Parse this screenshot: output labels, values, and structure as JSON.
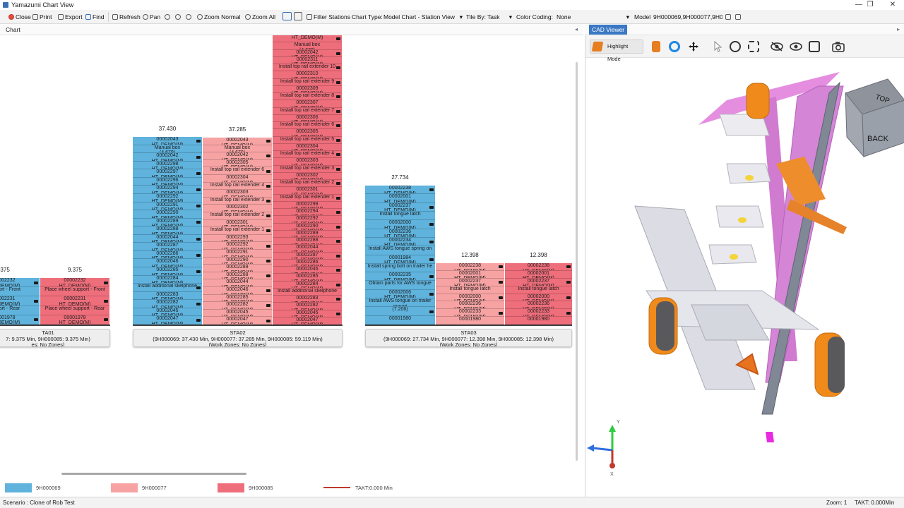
{
  "window": {
    "title": "Yamazumi Chart View",
    "minimize": "—",
    "maximize": "❐",
    "close": "✕"
  },
  "toolbar": {
    "close": "Close",
    "print": "Print",
    "export": "Export",
    "find": "Find",
    "refresh": "Refresh",
    "pan": "Pan",
    "zoom_normal": "Zoom Normal",
    "zoom_all": "Zoom All",
    "filter_stations": "Filter Stations",
    "chart_type_label": "Chart Type:",
    "chart_type_value": "Model Chart - Station View",
    "tile_by_label": "Tile By:",
    "tile_by_value": "Task",
    "color_coding_label": "Color Coding:",
    "color_coding_value": "None",
    "model_label": "Model",
    "model_value": "9H000069,9H000077,9H000("
  },
  "tabs": {
    "chart": "Chart",
    "cad": "CAD Viewer"
  },
  "colors": {
    "c69": "#5fb3dd",
    "c77": "#f7a3a3",
    "c85": "#ee6e7b",
    "takt": "#c0392b"
  },
  "chart": {
    "columns": [
      {
        "color": "c69",
        "top": "",
        "cells": [
          [
            "00002232",
            "HT_DEMO(M)"
          ],
          [
            "support - Front",
            ""
          ],
          [
            "00002231",
            "HT_DEMO(M)"
          ],
          [
            "support - Rear",
            ""
          ],
          [
            "00001978",
            "HT_DEMO(M)"
          ]
        ],
        "top_value": ".375"
      },
      {
        "color": "c85",
        "top": "",
        "cells": [
          [
            "00002232",
            "HT_DEMO(M)"
          ],
          [
            "Place wheel support - Front",
            ""
          ],
          [
            "00002231",
            "HT_DEMO(M)"
          ],
          [
            "Place wheel support - Rear",
            ""
          ],
          [
            "00001978",
            "HT_DEMO(M)"
          ]
        ],
        "top_value": "9.375"
      },
      {
        "color": "c69",
        "top_value": "37.430",
        "cells": [
          [
            "00002043",
            "HT_DEMO(M)"
          ],
          [
            "Manual box",
            "(4.679)"
          ],
          [
            "00002042",
            "HT_DEMO(M)"
          ],
          [
            "00002298",
            "HT_DEMO(M)"
          ],
          [
            "00002297",
            "HT_DEMO(M)"
          ],
          [
            "00002296",
            "HT_DEMO(M)"
          ],
          [
            "00002294",
            "HT_DEMO(M)"
          ],
          [
            "00002292",
            "HT_DEMO(M)"
          ],
          [
            "00002291",
            "HT_DEMO(M)"
          ],
          [
            "00002290",
            "HT_DEMO(M)"
          ],
          [
            "00002289",
            "HT_DEMO(M)"
          ],
          [
            "00002288",
            "HT_DEMO(M)"
          ],
          [
            "00002044",
            "HT_DEMO(M)"
          ],
          [
            "00002287",
            "HT_DEMO(M)"
          ],
          [
            "00002286",
            "HT_DEMO(M)"
          ],
          [
            "00002046",
            "HT_DEMO(M)"
          ],
          [
            "00002285",
            "HT_DEMO(M)"
          ],
          [
            "00002284",
            "HT_DEMO(M)"
          ],
          [
            "Install additional skelphone",
            ""
          ],
          [
            "00002283",
            "HT_DEMO(M)"
          ],
          [
            "00002282",
            "HT_DEMO(M)"
          ],
          [
            "00002045",
            "HT_DEMO(M)"
          ],
          [
            "00002047",
            "HT_DEMO(M)"
          ]
        ]
      },
      {
        "color": "c77",
        "top_value": "37.285",
        "cells": [
          [
            "00002043",
            "HT_DEMO(M)"
          ],
          [
            "Manual box",
            "(4.679)"
          ],
          [
            "00002042",
            "HT_DEMO(M)"
          ],
          [
            "00002305",
            "HT_DEMO(M)"
          ],
          [
            "Install top rail extender 6",
            ""
          ],
          [
            "00002304",
            "HT_DEMO(M)"
          ],
          [
            "Install top rail extender 4",
            ""
          ],
          [
            "00002303",
            "HT_DEMO(M)"
          ],
          [
            "Install top rail extender 3",
            ""
          ],
          [
            "00002302",
            "HT_DEMO(M)"
          ],
          [
            "Install top rail extender 2",
            ""
          ],
          [
            "00002301",
            "HT_DEMO(M)"
          ],
          [
            "Install top rail extender 1",
            ""
          ],
          [
            "00002293",
            "HT_DEMO(M)"
          ],
          [
            "00002292",
            "HT_DEMO(M)"
          ],
          [
            "00002291",
            "HT_DEMO(M)"
          ],
          [
            "00002290",
            "HT_DEMO(M)"
          ],
          [
            "00002289",
            "HT_DEMO(M)"
          ],
          [
            "00002288",
            "HT_DEMO(M)"
          ],
          [
            "00002044",
            "HT_DEMO(M)"
          ],
          [
            "00002046",
            "HT_DEMO(M)"
          ],
          [
            "00002285",
            "HT_DEMO(M)"
          ],
          [
            "00002282",
            "HT_DEMO(M)"
          ],
          [
            "00002045",
            "HT_DEMO(M)"
          ],
          [
            "00002047",
            "HT_DEMO(M)"
          ]
        ]
      },
      {
        "color": "c85",
        "top_value": "",
        "cells": [
          [
            "",
            "HT_DEMO(M)"
          ],
          [
            "Manual box",
            "(4.679)"
          ],
          [
            "00002042",
            "HT_DEMO(M)"
          ],
          [
            "00002311",
            "HT_DEMO(M)"
          ],
          [
            "Install top rail extender 10",
            ""
          ],
          [
            "00002310",
            "HT_DEMO(M)"
          ],
          [
            "Install top rail extender 9",
            ""
          ],
          [
            "00002309",
            "HT_DEMO(M)"
          ],
          [
            "Install top rail extender 8",
            ""
          ],
          [
            "00002307",
            "HT_DEMO(M)"
          ],
          [
            "Install top rail extender 7",
            ""
          ],
          [
            "00002306",
            "HT_DEMO(M)"
          ],
          [
            "Install top rail extender 6",
            ""
          ],
          [
            "00002305",
            "HT_DEMO(M)"
          ],
          [
            "Install top rail extender 5",
            ""
          ],
          [
            "00002304",
            "HT_DEMO(M)"
          ],
          [
            "Install top rail extender 4",
            ""
          ],
          [
            "00002303",
            "HT_DEMO(M)"
          ],
          [
            "Install top rail extender 3",
            ""
          ],
          [
            "00002302",
            "HT_DEMO(M)"
          ],
          [
            "Install top rail extender 2",
            ""
          ],
          [
            "00002301",
            "HT_DEMO(M)"
          ],
          [
            "Install top rail extender 1",
            ""
          ],
          [
            "00002298",
            "HT_DEMO(M)"
          ],
          [
            "00002294",
            "HT_DEMO(M)"
          ],
          [
            "00002292",
            "HT_DEMO(M)"
          ],
          [
            "00002290",
            "HT_DEMO(M)"
          ],
          [
            "00002289",
            "HT_DEMO(M)"
          ],
          [
            "00002288",
            "HT_DEMO(M)"
          ],
          [
            "00002044",
            "HT_DEMO(M)"
          ],
          [
            "00002287",
            "HT_DEMO(M)"
          ],
          [
            "00002286",
            "HT_DEMO(M)"
          ],
          [
            "00002046",
            "HT_DEMO(M)"
          ],
          [
            "00002285",
            "HT_DEMO(M)"
          ],
          [
            "00002284",
            "HT_DEMO(M)"
          ],
          [
            "Install additional skelphone",
            ""
          ],
          [
            "00002283",
            "HT_DEMO(M)"
          ],
          [
            "00002282",
            "HT_DEMO(M)"
          ],
          [
            "00002045",
            "HT_DEMO(M)"
          ],
          [
            "00002047",
            "HT_DEMO(M)"
          ]
        ]
      },
      {
        "color": "c69",
        "top_value": "27.734",
        "cells": [
          [
            "00002238",
            "HT_DEMO(M)"
          ],
          [
            "00002001",
            "HT_DEMO(M)"
          ],
          [
            "00002237",
            "HT_DEMO(M)"
          ],
          [
            "Install tongue latch",
            ""
          ],
          [
            "00002000",
            "HT_DEMO(M)"
          ],
          [
            "00002236",
            "HT_DEMO(M)"
          ],
          [
            "00002234",
            "HT_DEMO(M)"
          ],
          [
            "Install AWS tongue spring on",
            ""
          ],
          [
            "00001984",
            "HT_DEMO(M)"
          ],
          [
            "Install spring bolt on trailer he",
            ""
          ],
          [
            "00002235",
            "HT_DEMO(M)"
          ],
          [
            "Obtain parts for AWS tongue",
            ""
          ],
          [
            "00002006",
            "HT_DEMO(M)"
          ],
          [
            "Install AWS tongue on trailer",
            "mount"
          ],
          [
            "(7.206)",
            ""
          ],
          [
            "00001980",
            ""
          ]
        ]
      },
      {
        "color": "c77",
        "top_value": "12.398",
        "cells": [
          [
            "00002238",
            "HT_DEMO(M)"
          ],
          [
            "00002001",
            "HT_DEMO(M)"
          ],
          [
            "00002237",
            "HT_DEMO(M)"
          ],
          [
            "Install tongue latch",
            ""
          ],
          [
            "00002000",
            "HT_DEMO(M)"
          ],
          [
            "00002236",
            "HT_DEMO(M)"
          ],
          [
            "00002233",
            "HT_DEMO(M)"
          ],
          [
            "00001980",
            ""
          ]
        ]
      },
      {
        "color": "c85",
        "top_value": "12.398",
        "cells": [
          [
            "00002238",
            "HT_DEMO(M)"
          ],
          [
            "00002001",
            "HT_DEMO(M)"
          ],
          [
            "00002237",
            "HT_DEMO(M)"
          ],
          [
            "Install tongue latch",
            ""
          ],
          [
            "00002000",
            "HT_DEMO(M)"
          ],
          [
            "00002236",
            "HT_DEMO(M)"
          ],
          [
            "00002233",
            "HT_DEMO(M)"
          ],
          [
            "00001980",
            ""
          ]
        ]
      }
    ],
    "stations": [
      {
        "name": "TA01",
        "detail": "7: 9.375 Min, 9H000085: 9.375 Min)",
        "zones": "es: No Zones)"
      },
      {
        "name": "STA02",
        "detail": "(9H000069: 37.430 Min, 9H000077: 37.285 Min, 9H000085: 59.119 Min)",
        "zones": "(Work Zones: No Zones)"
      },
      {
        "name": "STA03",
        "detail": "(9H000069: 27.734 Min, 9H000077: 12.398 Min, 9H000085: 12.398 Min)",
        "zones": "(Work Zones: No Zones)"
      }
    ]
  },
  "legend": {
    "m1": "9H000069",
    "m2": "9H000077",
    "m3": "9H000085",
    "takt": "TAKT:0.000 Min"
  },
  "cad": {
    "highlight_mode": "Highlight Mode",
    "cube_top": "TOP",
    "cube_back": "BACK",
    "axis_y": "Y",
    "axis_x": "X"
  },
  "status": {
    "scenario": "Scenario : Clone of Rob Test",
    "zoom": "Zoom: 1",
    "takt": "TAKT: 0.000Min"
  }
}
